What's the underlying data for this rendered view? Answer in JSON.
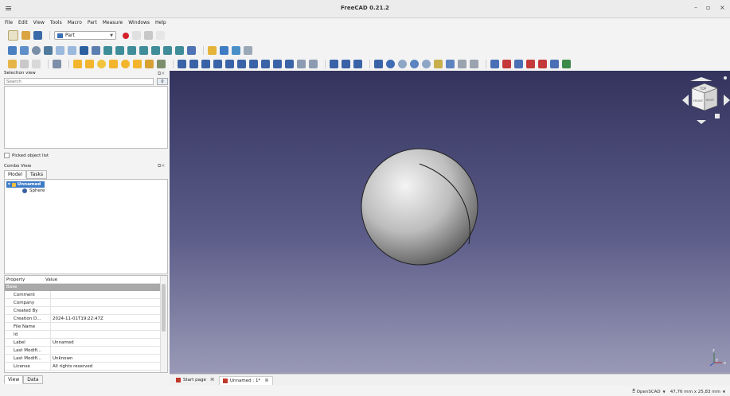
{
  "window": {
    "title": "FreeCAD 0.21.2",
    "minimize": "–",
    "maximize": "▫",
    "close": "×"
  },
  "menu": [
    "File",
    "Edit",
    "View",
    "Tools",
    "Macro",
    "Part",
    "Measure",
    "Windows",
    "Help"
  ],
  "workbench": {
    "selected": "Part"
  },
  "selection_view": {
    "title": "Selection view",
    "search_placeholder": "Search",
    "count": "0",
    "picked_label": "Picked object list"
  },
  "combo_view": {
    "title": "Combo View",
    "tabs": [
      "Model",
      "Tasks"
    ],
    "tree": [
      {
        "label": "Unnamed",
        "selected": true
      },
      {
        "label": "Sphere",
        "selected": false
      }
    ]
  },
  "properties": {
    "headers": [
      "Property",
      "Value"
    ],
    "group": "Base",
    "rows": [
      {
        "name": "Comment",
        "value": ""
      },
      {
        "name": "Company",
        "value": ""
      },
      {
        "name": "Created By",
        "value": ""
      },
      {
        "name": "Creation D...",
        "value": "2024-11-01T19:22:47Z"
      },
      {
        "name": "File Name",
        "value": ""
      },
      {
        "name": "Id",
        "value": ""
      },
      {
        "name": "Label",
        "value": "Unnamed"
      },
      {
        "name": "Last Modifi...",
        "value": ""
      },
      {
        "name": "Last Modifi...",
        "value": "Unknown"
      },
      {
        "name": "License",
        "value": "All rights reserved"
      }
    ]
  },
  "bottom_tabs": [
    "View",
    "Data"
  ],
  "doc_tabs": [
    {
      "label": "Start page"
    },
    {
      "label": "Unnamed : 1*"
    }
  ],
  "status": {
    "navigation": "OpenSCAD",
    "dimensions": "47,76 mm x 25,83 mm"
  },
  "navcube": {
    "top": "TOP",
    "front": "FRONT",
    "right": "RIGHT"
  },
  "colors": {
    "viewport_top": "#33335e",
    "viewport_bottom": "#9a9ab7",
    "selection": "#3d7bc6"
  }
}
